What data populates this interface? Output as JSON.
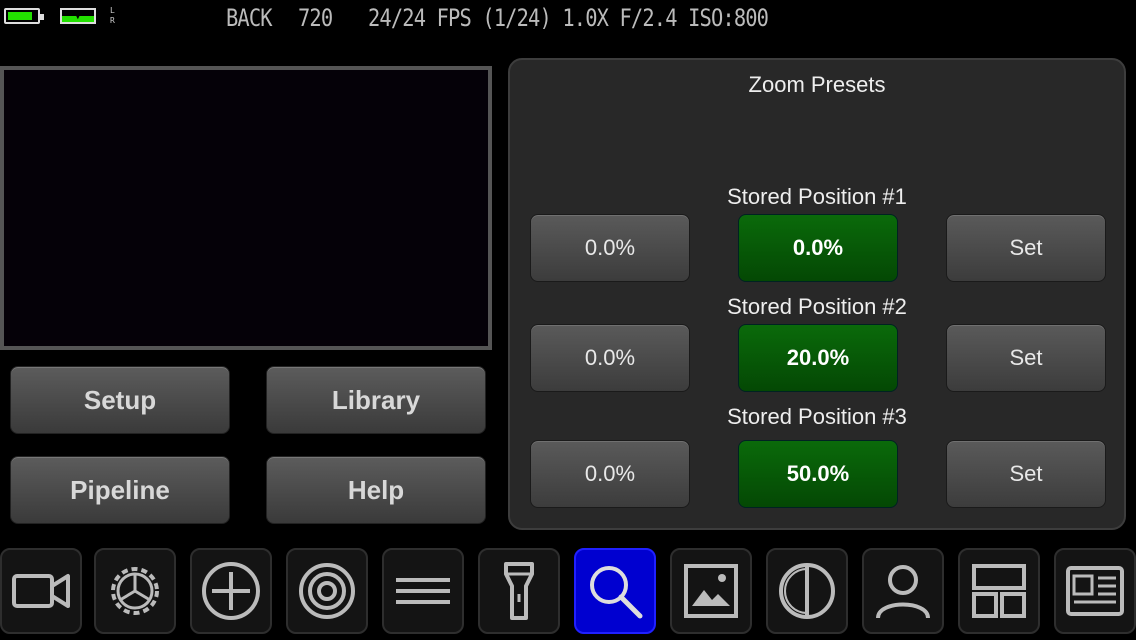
{
  "status": {
    "battery_level": 0.85,
    "audio_channels": "L R",
    "camera": "BACK",
    "resolution": "720",
    "exposure": "24/24 FPS (1/24) 1.0X F/2.4 ISO:800"
  },
  "colors": {
    "accent_green": "#23e000",
    "preset_green": "#0a6a0a",
    "active_blue": "#0000d0"
  },
  "menu": {
    "setup": "Setup",
    "library": "Library",
    "pipeline": "Pipeline",
    "help": "Help"
  },
  "zoom_presets": {
    "title": "Zoom Presets",
    "slots": [
      {
        "label": "Stored Position #1",
        "current": "0.0%",
        "stored": "0.0%",
        "set": "Set"
      },
      {
        "label": "Stored Position #2",
        "current": "0.0%",
        "stored": "20.0%",
        "set": "Set"
      },
      {
        "label": "Stored Position #3",
        "current": "0.0%",
        "stored": "50.0%",
        "set": "Set"
      }
    ]
  },
  "toolbar": {
    "items": [
      {
        "icon": "video-camera-icon"
      },
      {
        "icon": "gear-icon"
      },
      {
        "icon": "crosshair-plus-icon"
      },
      {
        "icon": "target-icon"
      },
      {
        "icon": "menu-lines-icon"
      },
      {
        "icon": "flashlight-icon"
      },
      {
        "icon": "search-icon",
        "active": true
      },
      {
        "icon": "image-icon"
      },
      {
        "icon": "exposure-contrast-icon"
      },
      {
        "icon": "person-icon"
      },
      {
        "icon": "layout-grid-icon"
      },
      {
        "icon": "news-layout-icon"
      }
    ]
  }
}
